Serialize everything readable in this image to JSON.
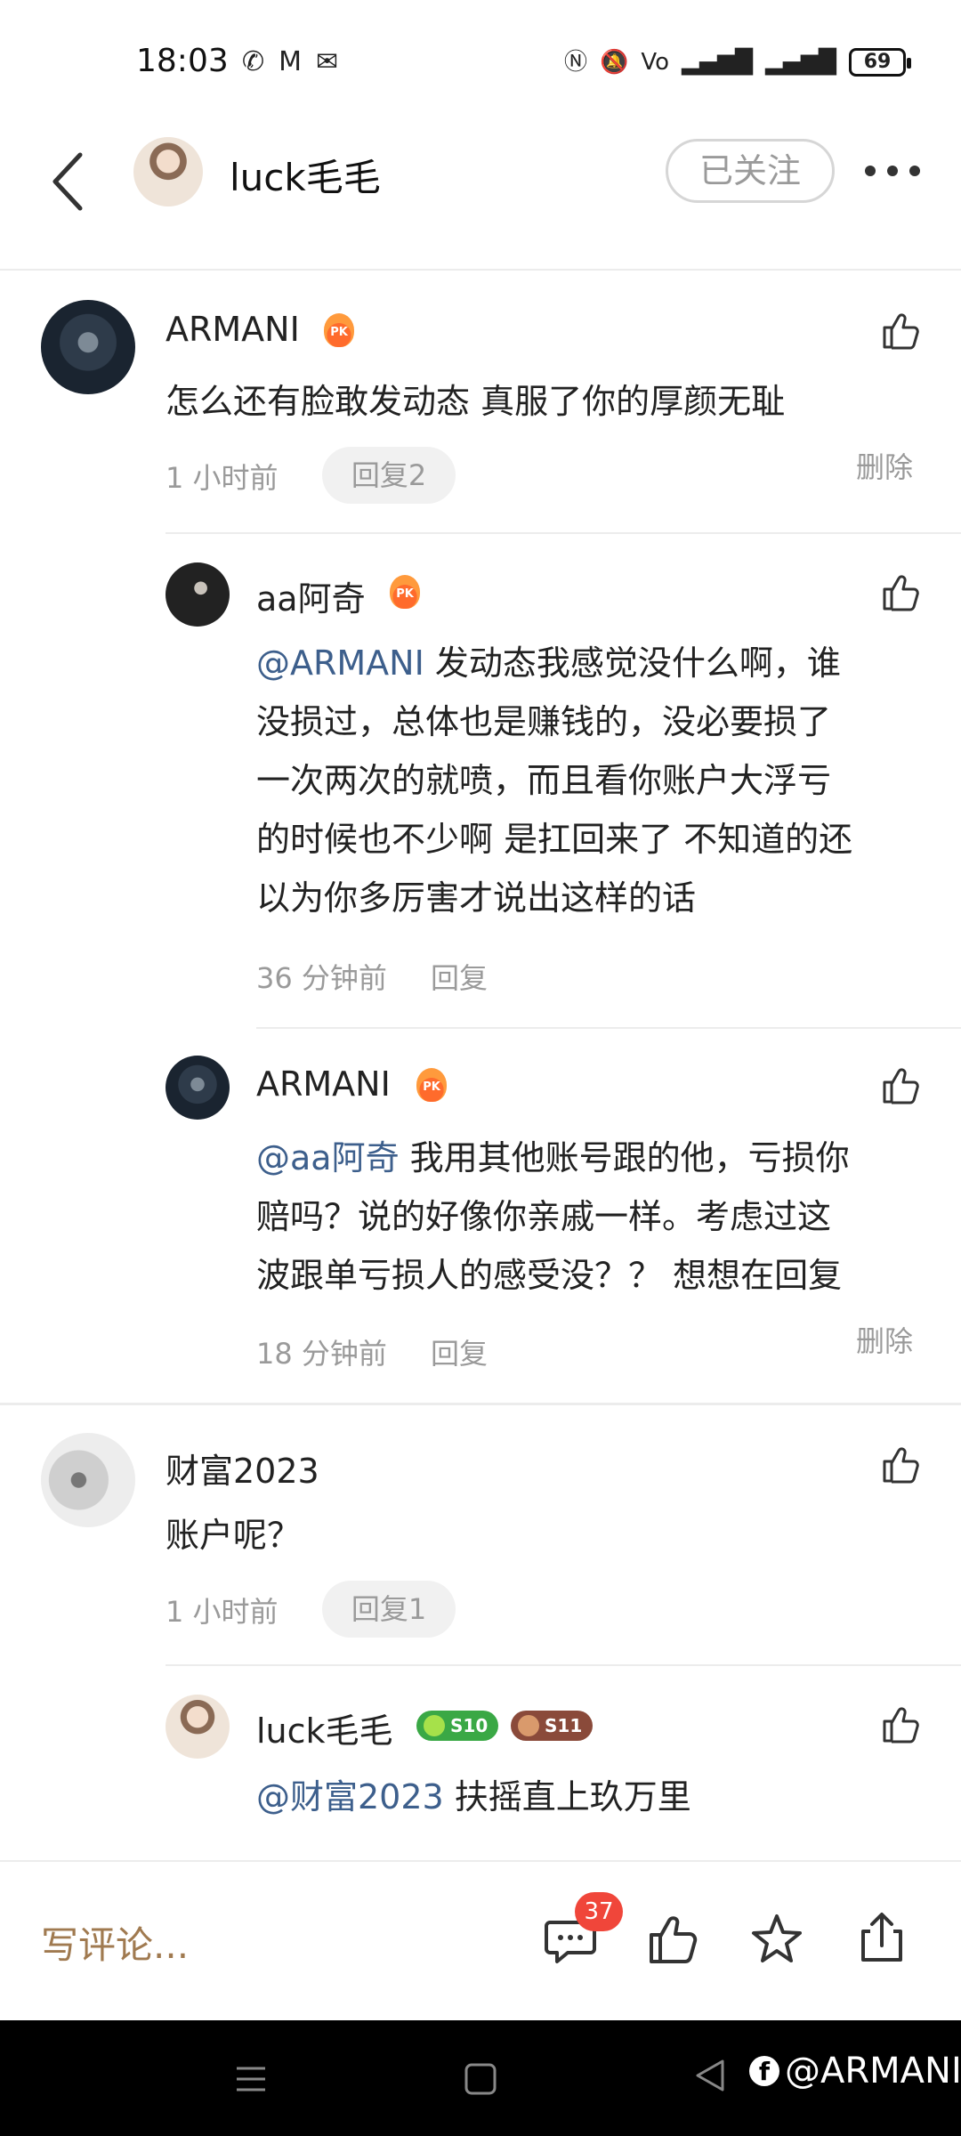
{
  "status_bar": {
    "time": "18:03",
    "left_icons": [
      "wechat-icon",
      "gmail-icon",
      "mail-icon"
    ],
    "right_icons": [
      "nfc-icon",
      "mute-icon",
      "volte-icon",
      "signal-4g-icon",
      "signal-r-icon"
    ],
    "battery": "69"
  },
  "header": {
    "name": "luck毛毛",
    "follow_label": "已关注"
  },
  "comments": [
    {
      "user": "ARMANI",
      "text": "怎么还有脸敢发动态 真服了你的厚颜无耻",
      "time": "1 小时前",
      "reply_label": "回复2",
      "delete_label": "删除",
      "replies": [
        {
          "user": "aa阿奇",
          "mention": "@ARMANI",
          "text_lines": [
            " 发动态我感觉没什么啊，谁",
            "没损过，总体也是赚钱的，没必要损了",
            "一次两次的就喷，而且看你账户大浮亏",
            "的时候也不少啊 是扛回来了 不知道的还",
            "以为你多厉害才说出这样的话"
          ],
          "time": "36 分钟前",
          "reply_label": "回复"
        },
        {
          "user": "ARMANI",
          "mention": "@aa阿奇",
          "text_lines": [
            " 我用其他账号跟的他，亏损你",
            "赔吗？说的好像你亲戚一样。考虑过这",
            "波跟单亏损人的感受没？？ 想想在回复"
          ],
          "time": "18 分钟前",
          "reply_label": "回复",
          "delete_label": "删除"
        }
      ]
    },
    {
      "user": "财富2023",
      "text": "账户呢？",
      "time": "1 小时前",
      "reply_label": "回复1",
      "replies": [
        {
          "user": "luck毛毛",
          "badges": [
            "S10",
            "S11"
          ],
          "mention": "@财富2023",
          "text": " 扶摇直上玖万里"
        }
      ]
    }
  ],
  "bottom_bar": {
    "write_placeholder": "写评论...",
    "comment_count": "37",
    "icons": [
      "comment-icon",
      "like-icon",
      "star-icon",
      "share-icon"
    ]
  },
  "watermark": "@ARMANI",
  "colors": {
    "mention": "#3d5f8c",
    "write_comment": "#a07a50",
    "badge_red": "#f0463a",
    "pk_orange": "#ff6b2c"
  }
}
